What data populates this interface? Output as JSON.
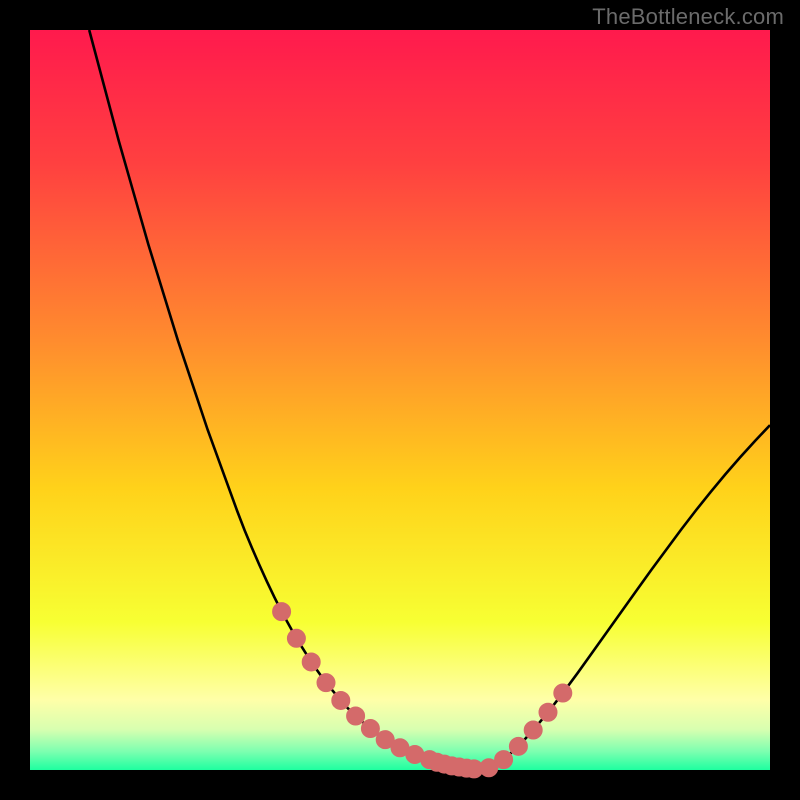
{
  "watermark": {
    "text": "TheBottleneck.com"
  },
  "colors": {
    "frame": "#000000",
    "curve": "#000000",
    "marker_fill": "#d46a6a",
    "marker_stroke": "#d46a6a",
    "gradient_stops": [
      {
        "offset": 0.0,
        "color": "#ff1a4d"
      },
      {
        "offset": 0.18,
        "color": "#ff4040"
      },
      {
        "offset": 0.42,
        "color": "#ff8c2e"
      },
      {
        "offset": 0.62,
        "color": "#ffd21a"
      },
      {
        "offset": 0.8,
        "color": "#f7ff33"
      },
      {
        "offset": 0.905,
        "color": "#ffffa8"
      },
      {
        "offset": 0.945,
        "color": "#d8ffb0"
      },
      {
        "offset": 0.975,
        "color": "#7dffb0"
      },
      {
        "offset": 1.0,
        "color": "#1effa0"
      }
    ]
  },
  "chart_data": {
    "type": "line",
    "title": "",
    "xlabel": "",
    "ylabel": "",
    "xlim": [
      0,
      100
    ],
    "ylim": [
      0,
      100
    ],
    "x": [
      8,
      10,
      12,
      14,
      16,
      18,
      20,
      22,
      24,
      26,
      28,
      29,
      30,
      31,
      32,
      33,
      34,
      35,
      36,
      37,
      38,
      39,
      40,
      41,
      42,
      43,
      44,
      46,
      48,
      50,
      52,
      54,
      56,
      58,
      60,
      62,
      64,
      66,
      68,
      70,
      72,
      74,
      76,
      78,
      80,
      82,
      84,
      86,
      88,
      90,
      92,
      94,
      96,
      98,
      100
    ],
    "values": [
      100,
      92.5,
      85,
      78,
      71,
      64.5,
      58,
      52,
      46,
      40.5,
      35,
      32.4,
      30,
      27.7,
      25.5,
      23.4,
      21.4,
      19.6,
      17.8,
      16.2,
      14.6,
      13.2,
      11.8,
      10.6,
      9.4,
      8.3,
      7.3,
      5.6,
      4.1,
      3,
      2.1,
      1.4,
      0.8,
      0.4,
      0.15,
      0.3,
      1.4,
      3.2,
      5.4,
      7.8,
      10.4,
      13.1,
      15.9,
      18.7,
      21.5,
      24.3,
      27.1,
      29.8,
      32.5,
      35.1,
      37.6,
      40,
      42.3,
      44.5,
      46.6
    ],
    "markers": {
      "x": [
        34,
        36,
        38,
        40,
        42,
        44,
        46,
        48,
        50,
        52,
        54,
        55,
        56,
        57,
        58,
        59,
        60,
        62,
        64,
        66,
        68,
        70,
        72
      ],
      "values": [
        21.4,
        17.8,
        14.6,
        11.8,
        9.4,
        7.3,
        5.6,
        4.1,
        3,
        2.1,
        1.4,
        1.05,
        0.8,
        0.55,
        0.4,
        0.25,
        0.15,
        0.3,
        1.4,
        3.2,
        5.4,
        7.8,
        10.4
      ]
    }
  }
}
